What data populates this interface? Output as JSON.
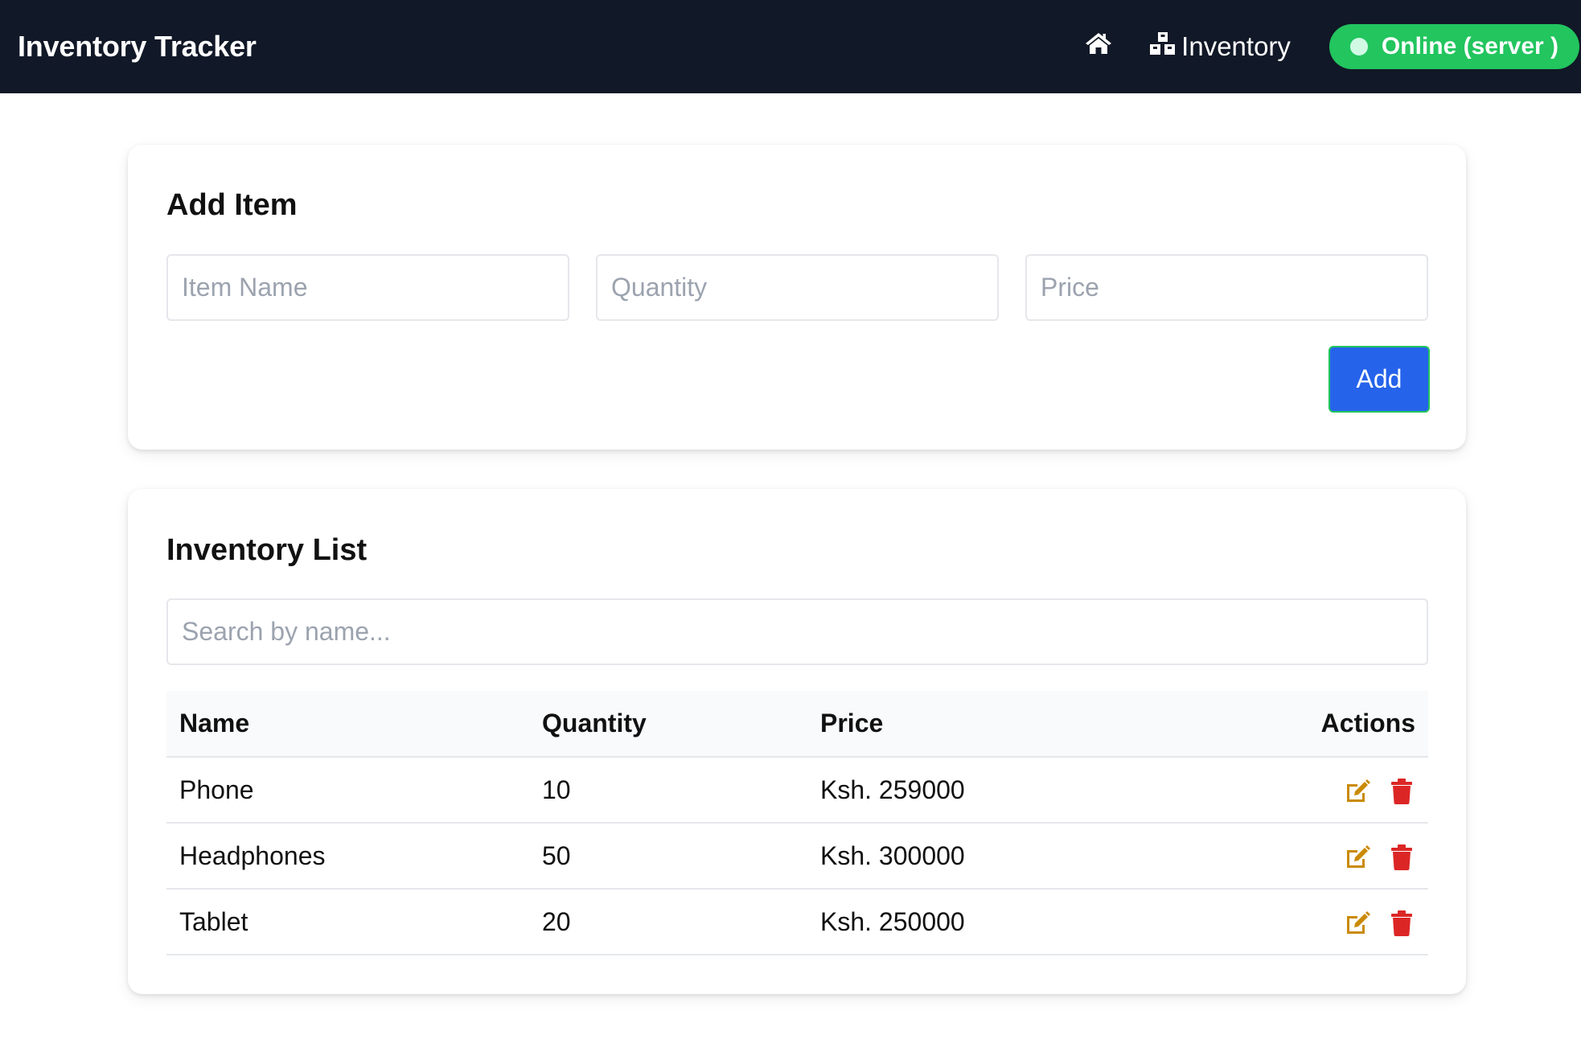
{
  "navbar": {
    "brand": "Inventory Tracker",
    "home_icon": "home-icon",
    "inventory_icon": "boxes-icon",
    "inventory_label": "Inventory",
    "status_label": "Online (server )",
    "status_color": "#22c55e"
  },
  "add_item": {
    "title": "Add Item",
    "name_placeholder": "Item Name",
    "name_value": "",
    "quantity_placeholder": "Quantity",
    "quantity_value": "",
    "price_placeholder": "Price",
    "price_value": "",
    "add_label": "Add",
    "add_color": "#2563eb"
  },
  "inventory_list": {
    "title": "Inventory List",
    "search_placeholder": "Search by name...",
    "search_value": "",
    "columns": [
      "Name",
      "Quantity",
      "Price",
      "Actions"
    ],
    "rows": [
      {
        "name": "Phone",
        "quantity": "10",
        "price": "Ksh. 259000"
      },
      {
        "name": "Headphones",
        "quantity": "50",
        "price": "Ksh. 300000"
      },
      {
        "name": "Tablet",
        "quantity": "20",
        "price": "Ksh. 250000"
      }
    ],
    "edit_icon": "edit-icon",
    "delete_icon": "trash-icon",
    "edit_color": "#ca8a04",
    "delete_color": "#dc2626"
  }
}
